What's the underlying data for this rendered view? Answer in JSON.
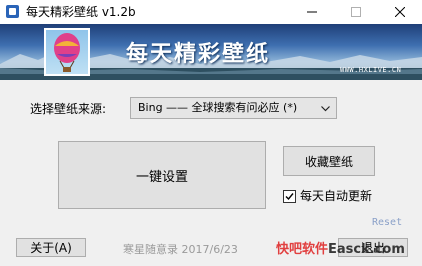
{
  "window": {
    "title": "每天精彩壁纸 v1.2b",
    "icon": "app-icon"
  },
  "banner": {
    "title": "每天精彩壁纸",
    "site": "WWW.HXLIVE.CN"
  },
  "source": {
    "label": "选择壁纸来源:",
    "selected": "Bing —— 全球搜索有问必应 (*)"
  },
  "buttons": {
    "setup": "一键设置",
    "collect": "收藏壁纸",
    "about": "关于(A)",
    "exit": "退出"
  },
  "auto_update": {
    "label": "每天自动更新",
    "checked": true
  },
  "reset": "Reset",
  "credit": "寒星随意录  2017/6/23",
  "watermark": {
    "part1": "快吧软件",
    "part2": "Easck.com"
  },
  "colors": {
    "accent": "#2a64b8",
    "watermark": "#e03030",
    "reset": "#8aa0c8"
  }
}
